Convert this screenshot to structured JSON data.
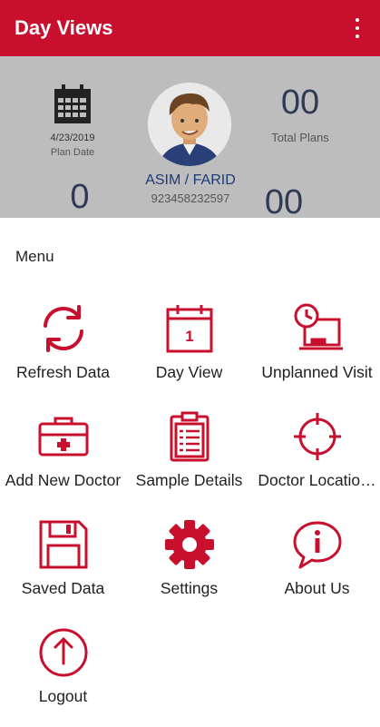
{
  "appbar": {
    "title": "Day Views",
    "overflow_icon": "more-vert-icon"
  },
  "header": {
    "calendar_icon": "calendar-grid-icon",
    "plan_date": "4/23/2019",
    "plan_date_label": "Plan Date",
    "user_name": "ASIM / FARID",
    "phone": "923458232597",
    "total_plans_count": "00",
    "total_plans_label": "Total Plans",
    "left_count": "0",
    "right_count": "00"
  },
  "menu": {
    "title": "Menu",
    "items": [
      {
        "label": "Refresh Data",
        "icon": "refresh-icon"
      },
      {
        "label": "Day View",
        "icon": "calendar-day-icon",
        "badge": "1"
      },
      {
        "label": "Unplanned Visit",
        "icon": "unplanned-visit-icon"
      },
      {
        "label": "Add New Doctor",
        "icon": "medical-kit-icon"
      },
      {
        "label": "Sample Details",
        "icon": "clipboard-icon"
      },
      {
        "label": "Doctor Locatio…",
        "icon": "crosshair-icon"
      },
      {
        "label": "Saved Data",
        "icon": "floppy-disk-icon"
      },
      {
        "label": "Settings",
        "icon": "gear-icon"
      },
      {
        "label": "About Us",
        "icon": "info-bubble-icon"
      },
      {
        "label": "Logout",
        "icon": "logout-icon"
      }
    ]
  },
  "colors": {
    "primary": "#c8102e",
    "header_bg": "#bdbdbd",
    "name_blue": "#1d3a78"
  }
}
